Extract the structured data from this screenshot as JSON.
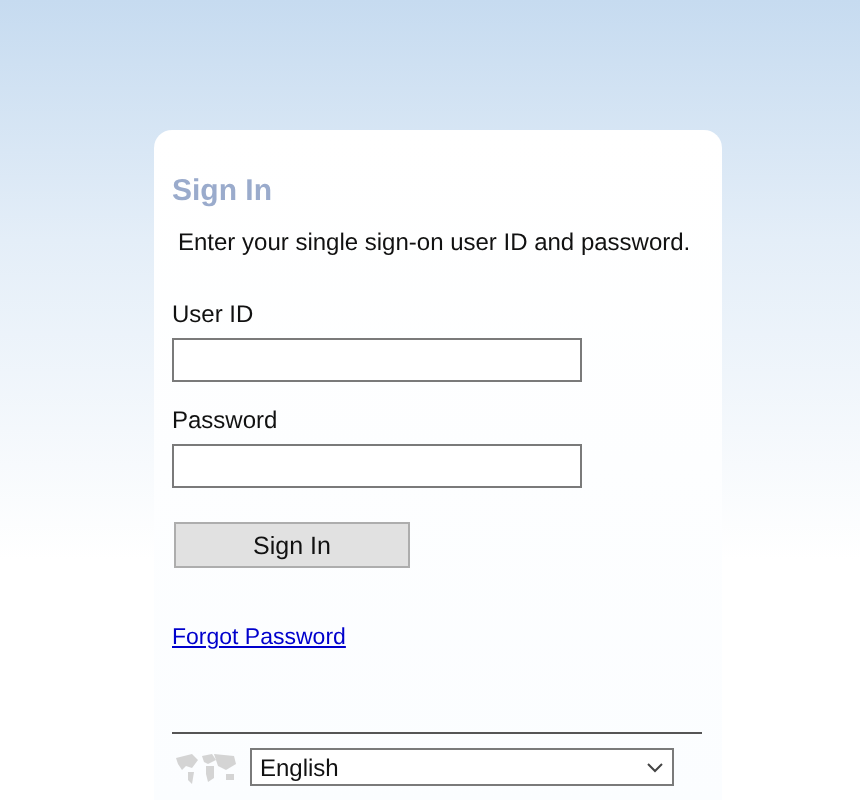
{
  "title": "Sign In",
  "instruction": "Enter your single sign-on user ID and password.",
  "fields": [
    {
      "label": "User ID"
    },
    {
      "label": "Password"
    }
  ],
  "submit": "Sign In",
  "forgot_link": "Forgot Password",
  "language": {
    "value": "English"
  }
}
